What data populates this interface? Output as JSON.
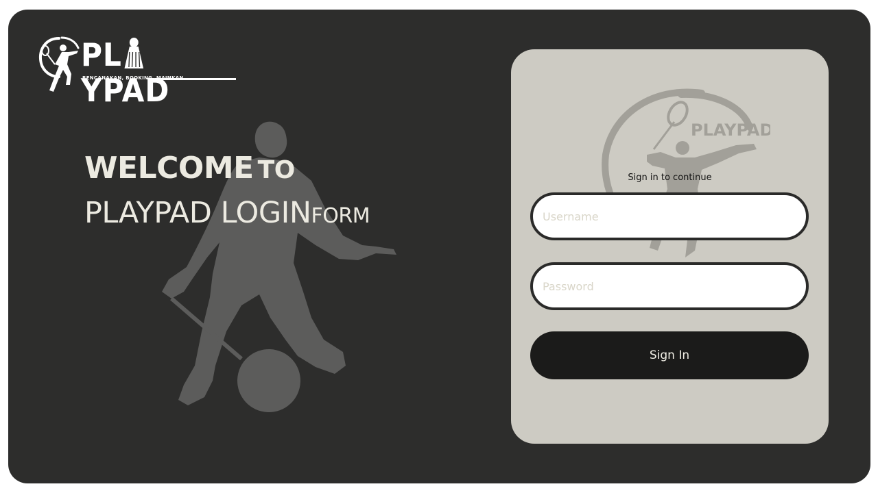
{
  "brand": {
    "name_prefix": "PL",
    "name_suffix": "YPAD",
    "tagline": "RENCANAKAN, BOOKING, MAINKAN",
    "watermark_text": "PLAYPAD",
    "emblem_icon": "badminton-player-icon",
    "shuttle_icon": "shuttlecock-icon"
  },
  "welcome": {
    "line1_big": "WELCOME",
    "line1_small": "TO",
    "line2_big": "PLAYPAD LOGIN",
    "line2_small": "FORM"
  },
  "login": {
    "subtitle": "Sign in to continue",
    "username_placeholder": "Username",
    "password_placeholder": "Password",
    "submit_label": "Sign In"
  },
  "colors": {
    "background": "#2d2d2c",
    "card": "#cdcbc3",
    "button": "#1b1b1a",
    "text_light": "#eceae1"
  }
}
